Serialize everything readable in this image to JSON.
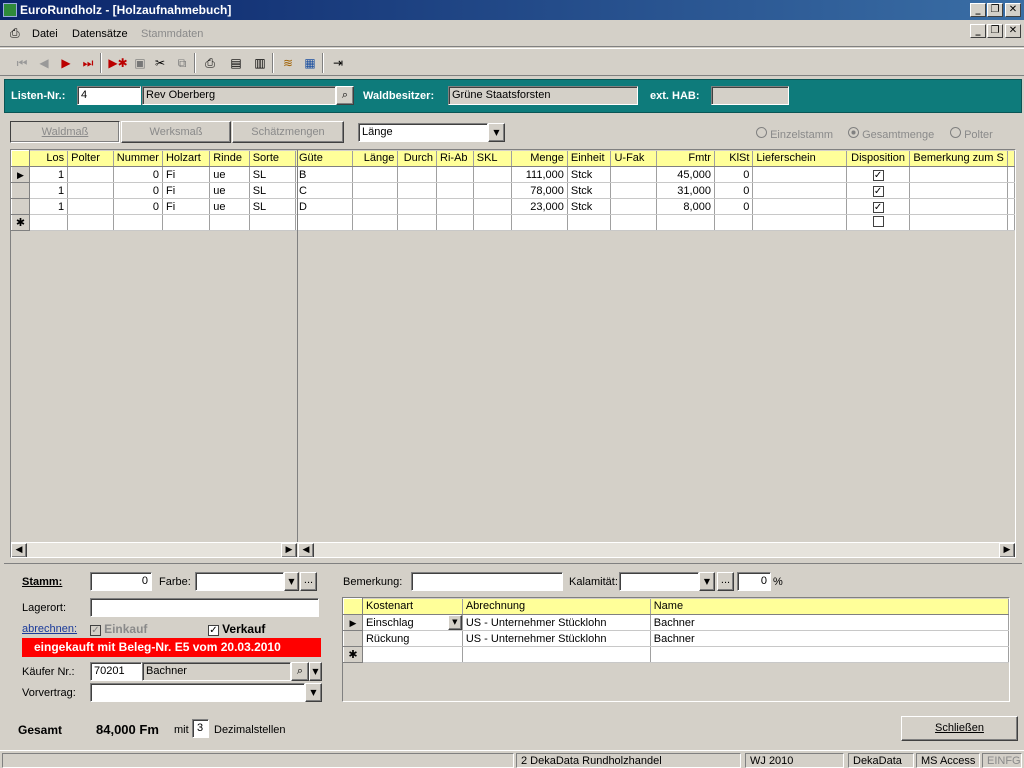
{
  "window": {
    "title": "EuroRundholz - [Holzaufnahmebuch]"
  },
  "menu": {
    "items": [
      {
        "label": "Datei",
        "disabled": false
      },
      {
        "label": "Datensätze",
        "disabled": false
      },
      {
        "label": "Stammdaten",
        "disabled": true
      }
    ]
  },
  "header": {
    "listen_label": "Listen-Nr.:",
    "listen_value": "4",
    "revier_value": "Rev Oberberg",
    "waldbesitzer_label": "Waldbesitzer:",
    "waldbesitzer_value": "Grüne Staatsforsten",
    "exthab_label": "ext. HAB:",
    "exthab_value": ""
  },
  "tabs": [
    "Waldmaß",
    "Werksmaß",
    "Schätzmengen"
  ],
  "combo_laenge": "Länge",
  "radios": [
    "Einzelstamm",
    "Gesamtmenge",
    "Polter"
  ],
  "radio_selected": "Gesamtmenge",
  "grid": {
    "columns": [
      "Los",
      "Polter",
      "Nummer",
      "Holzart",
      "Rinde",
      "Sorte",
      "Güte",
      "Länge",
      "Durch",
      "Ri-Ab",
      "SKL",
      "Menge",
      "Einheit",
      "U-Fak",
      "Fmtr",
      "KlSt",
      "Lieferschein",
      "Disposition",
      "Bemerkung zum S"
    ],
    "rows": [
      [
        "1",
        "",
        "0",
        "Fi",
        "ue",
        "SL",
        "B",
        "",
        "",
        "",
        "",
        "111,000",
        "Stck",
        "",
        "45,000",
        "0",
        "",
        "checked",
        ""
      ],
      [
        "1",
        "",
        "0",
        "Fi",
        "ue",
        "SL",
        "C",
        "",
        "",
        "",
        "",
        "78,000",
        "Stck",
        "",
        "31,000",
        "0",
        "",
        "checked",
        ""
      ],
      [
        "1",
        "",
        "0",
        "Fi",
        "ue",
        "SL",
        "D",
        "",
        "",
        "",
        "",
        "23,000",
        "Stck",
        "",
        "8,000",
        "0",
        "",
        "checked",
        ""
      ]
    ]
  },
  "form": {
    "stamm_label": "Stamm:",
    "stamm_value": "0",
    "farbe_label": "Farbe:",
    "farbe_value": "",
    "lagerort_label": "Lagerort:",
    "lagerort_value": "",
    "abrechnen_label": "abrechnen:",
    "einkauf_label": "Einkauf",
    "verkauf_label": "Verkauf",
    "banner": "eingekauft mit Beleg-Nr. E5 vom 20.03.2010",
    "kaeufer_label": "Käufer Nr.:",
    "kaeufer_nr": "70201",
    "kaeufer_name": "Bachner",
    "vorvertrag_label": "Vorvertrag:",
    "vorvertrag_value": "",
    "bemerkung_label": "Bemerkung:",
    "bemerkung_value": "",
    "kalamitaet_label": "Kalamität:",
    "kalamitaet_value": "",
    "kalamitaet_pct": "0",
    "pct_sign": "%"
  },
  "kosten": {
    "columns": [
      "Kostenart",
      "Abrechnung",
      "Name"
    ],
    "rows": [
      [
        "Einschlag",
        "US - Unternehmer Stücklohn",
        "Bachner"
      ],
      [
        "Rückung",
        "US - Unternehmer Stücklohn",
        "Bachner"
      ]
    ]
  },
  "footer": {
    "gesamt_label": "Gesamt",
    "gesamt_value": "84,000 Fm",
    "mit_label": "mit",
    "dezimal_value": "3",
    "dezimal_label": "Dezimalstellen",
    "close_label": "Schließen"
  },
  "status": {
    "panels": [
      "",
      "2 DekaData Rundholzhandel",
      "WJ 2010",
      "DekaData",
      "MS Access",
      "EINFG"
    ]
  }
}
